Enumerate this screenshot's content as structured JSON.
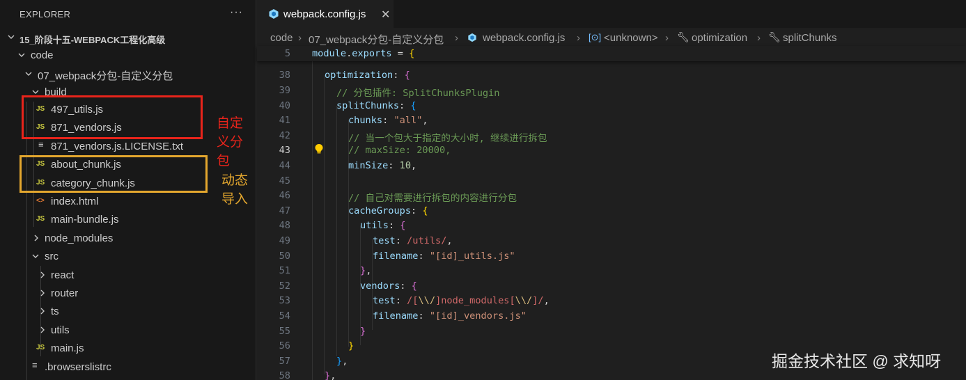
{
  "explorer": {
    "title": "EXPLORER",
    "more_icon": "ellipsis-icon",
    "root": "15_阶段十五-WEBPACK工程化高级",
    "tree": {
      "code": "code",
      "webpack_folder": "07_webpack分包-自定义分包",
      "build": "build",
      "utils_js": "497_utils.js",
      "vendors_js": "871_vendors.js",
      "license": "871_vendors.js.LICENSE.txt",
      "about_chunk": "about_chunk.js",
      "category_chunk": "category_chunk.js",
      "index_html": "index.html",
      "main_bundle": "main-bundle.js",
      "node_modules": "node_modules",
      "src": "src",
      "react": "react",
      "router": "router",
      "ts": "ts",
      "utils": "utils",
      "main_js": "main.js",
      "browserslistrc": ".browserslistrc"
    },
    "icons": {
      "js": "JS",
      "html": "<>",
      "txt": "≡"
    }
  },
  "annotations": {
    "custom_split": "自定义分包",
    "dynamic_import": "动态导入",
    "red": "#e8241b",
    "orange": "#e4a72e"
  },
  "editor": {
    "tab": {
      "label": "webpack.config.js",
      "close": "✕",
      "icon": "webpack-icon"
    },
    "breadcrumb": [
      "code",
      "07_webpack分包-自定义分包",
      "webpack.config.js",
      "<unknown>",
      "optimization",
      "splitChunks"
    ],
    "sticky_line_number": "5",
    "sticky_line": "module.exports = {",
    "line_numbers": [
      "38",
      "39",
      "40",
      "41",
      "42",
      "43",
      "44",
      "45",
      "46",
      "47",
      "48",
      "49",
      "50",
      "51",
      "52",
      "53",
      "54",
      "55",
      "56",
      "57",
      "58"
    ],
    "active_line": "43"
  },
  "watermark": "掘金技术社区 @ 求知呀"
}
